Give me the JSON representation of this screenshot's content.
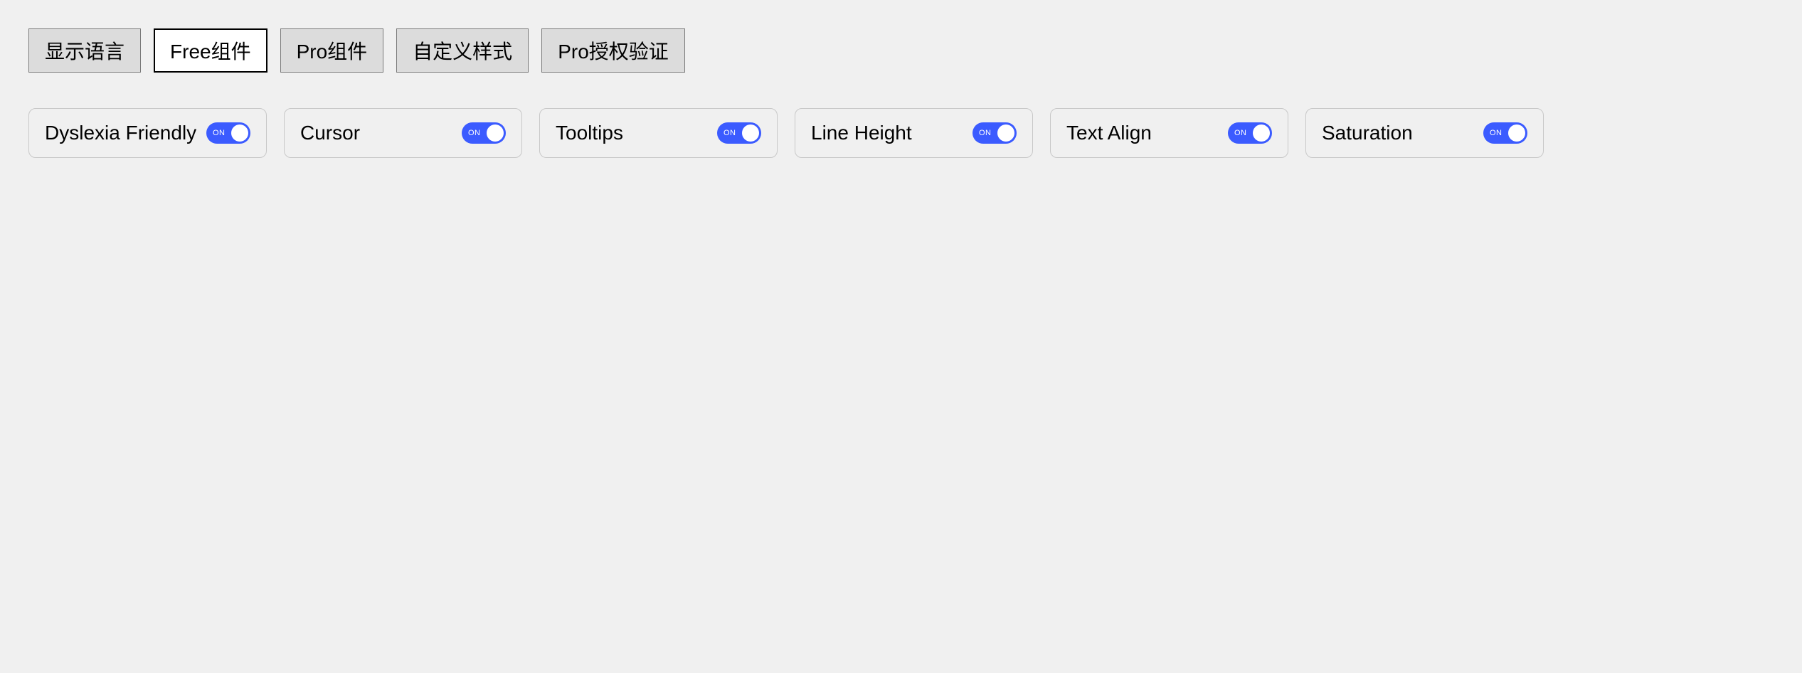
{
  "tabs": [
    {
      "label": "显示语言",
      "active": false
    },
    {
      "label": "Free组件",
      "active": true
    },
    {
      "label": "Pro组件",
      "active": false
    },
    {
      "label": "自定义样式",
      "active": false
    },
    {
      "label": "Pro授权验证",
      "active": false
    }
  ],
  "toggleText": "ON",
  "settings": [
    {
      "label": "Dyslexia Friendly",
      "on": true
    },
    {
      "label": "Cursor",
      "on": true
    },
    {
      "label": "Tooltips",
      "on": true
    },
    {
      "label": "Line Height",
      "on": true
    },
    {
      "label": "Text Align",
      "on": true
    },
    {
      "label": "Saturation",
      "on": true
    }
  ]
}
